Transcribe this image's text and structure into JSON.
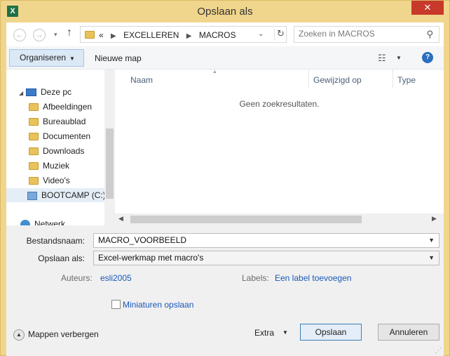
{
  "window": {
    "title": "Opslaan als",
    "app_icon": "X",
    "close_label": "✕"
  },
  "address": {
    "back_icon": "arrow-left-icon",
    "forward_icon": "arrow-right-icon",
    "up_icon": "arrow-up-icon",
    "overflow": "«",
    "breadcrumbs": [
      "EXCELLEREN",
      "MACROS"
    ],
    "search_placeholder": "Zoeken in MACROS"
  },
  "toolbar": {
    "organize_label": "Organiseren",
    "new_folder_label": "Nieuwe map"
  },
  "navpane": {
    "items": [
      {
        "label": "Deze pc",
        "icon": "computer-icon"
      },
      {
        "label": "Afbeeldingen",
        "icon": "folder-icon"
      },
      {
        "label": "Bureaublad",
        "icon": "folder-icon"
      },
      {
        "label": "Documenten",
        "icon": "folder-icon"
      },
      {
        "label": "Downloads",
        "icon": "folder-icon"
      },
      {
        "label": "Muziek",
        "icon": "folder-icon"
      },
      {
        "label": "Video's",
        "icon": "folder-icon"
      },
      {
        "label": "BOOTCAMP (C:)",
        "icon": "drive-icon"
      },
      {
        "label": "Netwerk",
        "icon": "network-icon"
      }
    ]
  },
  "filepane": {
    "columns": [
      "Naam",
      "Gewijzigd op",
      "Type"
    ],
    "empty_message": "Geen zoekresultaten."
  },
  "form": {
    "filename_label": "Bestandsnaam:",
    "filename_value": "MACRO_VOORBEELD",
    "savetype_label": "Opslaan als:",
    "savetype_value": "Excel-werkmap met macro's",
    "authors_label": "Auteurs:",
    "authors_value": "esli2005",
    "labels_label": "Labels:",
    "labels_value": "Een label toevoegen",
    "thumbnails_label": "Miniaturen opslaan",
    "hide_folders_label": "Mappen verbergen",
    "extra_label": "Extra",
    "save_label": "Opslaan",
    "cancel_label": "Annuleren"
  }
}
